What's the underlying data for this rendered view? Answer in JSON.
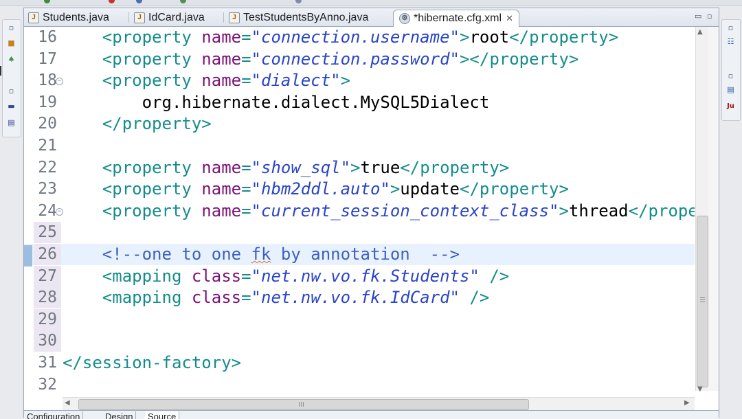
{
  "editor": {
    "tabs": [
      {
        "label": "Students.java",
        "icon": "java-file-icon",
        "active": false
      },
      {
        "label": "IdCard.java",
        "icon": "java-file-icon",
        "active": false
      },
      {
        "label": "TestStudentsByAnno.java",
        "icon": "java-file-icon",
        "active": false
      },
      {
        "label": "*hibernate.cfg.xml",
        "icon": "xml-config-icon",
        "active": true
      }
    ],
    "close_glyph": "✕",
    "current_line": 26,
    "lines": [
      {
        "n": "16",
        "tokens": [
          [
            "tag",
            "<property "
          ],
          [
            "attr",
            "name"
          ],
          [
            "tag",
            "="
          ],
          [
            "val",
            "\"connection.username\""
          ],
          [
            "tag",
            ">"
          ],
          [
            "text",
            "root"
          ],
          [
            "tag",
            "</property>"
          ]
        ]
      },
      {
        "n": "17",
        "tokens": [
          [
            "tag",
            "<property "
          ],
          [
            "attr",
            "name"
          ],
          [
            "tag",
            "="
          ],
          [
            "val",
            "\"connection.password\""
          ],
          [
            "tag",
            "></property>"
          ]
        ]
      },
      {
        "n": "18",
        "fold": true,
        "tokens": [
          [
            "tag",
            "<property "
          ],
          [
            "attr",
            "name"
          ],
          [
            "tag",
            "="
          ],
          [
            "val",
            "\"dialect\""
          ],
          [
            "tag",
            ">"
          ]
        ]
      },
      {
        "n": "19",
        "tokens": [
          [
            "text",
            "    org.hibernate.dialect.MySQL5Dialect"
          ]
        ]
      },
      {
        "n": "20",
        "tokens": [
          [
            "tag",
            "</property>"
          ]
        ]
      },
      {
        "n": "21",
        "tokens": []
      },
      {
        "n": "22",
        "tokens": [
          [
            "tag",
            "<property "
          ],
          [
            "attr",
            "name"
          ],
          [
            "tag",
            "="
          ],
          [
            "val",
            "\"show_sql\""
          ],
          [
            "tag",
            ">"
          ],
          [
            "text",
            "true"
          ],
          [
            "tag",
            "</property>"
          ]
        ]
      },
      {
        "n": "23",
        "tokens": [
          [
            "tag",
            "<property "
          ],
          [
            "attr",
            "name"
          ],
          [
            "tag",
            "="
          ],
          [
            "val",
            "\"hbm2ddl.auto\""
          ],
          [
            "tag",
            ">"
          ],
          [
            "text",
            "update"
          ],
          [
            "tag",
            "</property>"
          ]
        ]
      },
      {
        "n": "24",
        "fold": true,
        "tokens": [
          [
            "tag",
            "<property "
          ],
          [
            "attr",
            "name"
          ],
          [
            "tag",
            "="
          ],
          [
            "val",
            "\"current_session_context_class\""
          ],
          [
            "tag",
            ">"
          ],
          [
            "text",
            "thread"
          ],
          [
            "tag",
            "</property>"
          ]
        ]
      },
      {
        "n": "25",
        "tokens": []
      },
      {
        "n": "26",
        "tokens": [
          [
            "cmt",
            "<!--one to one "
          ],
          [
            "cmt-sq",
            "fk"
          ],
          [
            "cmt",
            " by annotation  -->"
          ]
        ]
      },
      {
        "n": "27",
        "tokens": [
          [
            "tag",
            "<mapping "
          ],
          [
            "attr",
            "class"
          ],
          [
            "tag",
            "="
          ],
          [
            "val",
            "\"net.nw.vo.fk.Students\""
          ],
          [
            "tag",
            " />"
          ]
        ]
      },
      {
        "n": "28",
        "tokens": [
          [
            "tag",
            "<mapping "
          ],
          [
            "attr",
            "class"
          ],
          [
            "tag",
            "="
          ],
          [
            "val",
            "\"net.nw.vo.fk.IdCard\""
          ],
          [
            "tag",
            " />"
          ]
        ]
      },
      {
        "n": "29",
        "tokens": []
      },
      {
        "n": "30",
        "tokens": []
      },
      {
        "n": "31",
        "tokens": [
          [
            "tag",
            "</session-factory>"
          ]
        ]
      },
      {
        "n": "32",
        "tokens": []
      }
    ],
    "bottom_tabs": [
      "Configuration",
      "Design",
      "Source"
    ],
    "bottom_active": "Source"
  },
  "colors": {
    "tag": "#148c8c",
    "attr": "#7a1277",
    "value": "#2a44c8",
    "comment": "#3d5fbf",
    "current_line_bg": "#e8f2fe"
  }
}
